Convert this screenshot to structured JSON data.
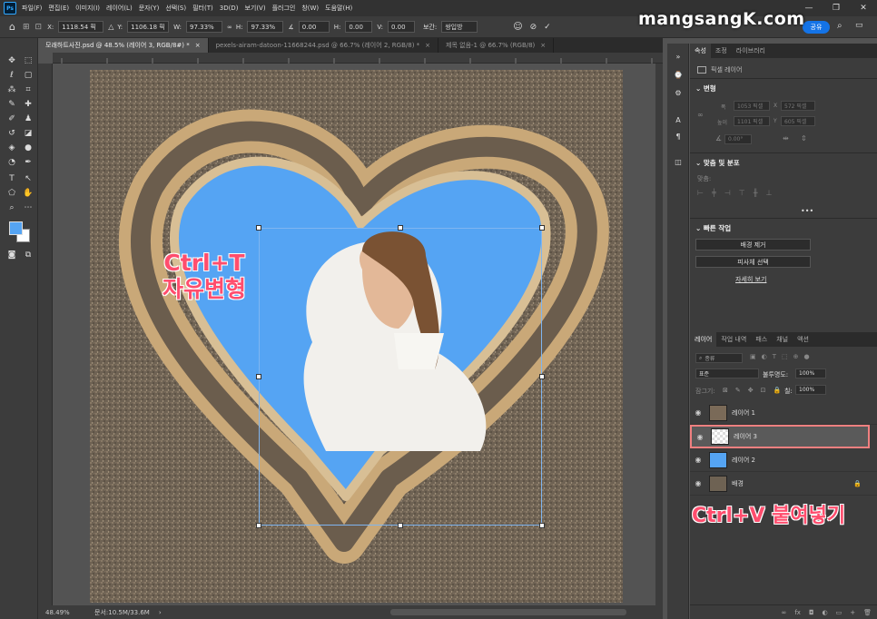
{
  "menubar": {
    "logo": "Ps",
    "items": [
      "파일(F)",
      "편집(E)",
      "이미지(I)",
      "레이어(L)",
      "문자(Y)",
      "선택(S)",
      "필터(T)",
      "3D(D)",
      "보기(V)",
      "플러그인",
      "창(W)",
      "도움말(H)"
    ],
    "window_controls": [
      "—",
      "❐",
      "✕"
    ]
  },
  "options": {
    "x_label": "X:",
    "x_value": "1118.54 픽",
    "y_label": "Y:",
    "y_value": "1106.18 픽",
    "w_label": "W:",
    "w_value": "97.33%",
    "h_label": "H:",
    "h_value": "97.33%",
    "angle_value": "0.00",
    "hskew_label": "H:",
    "hskew_value": "0.00",
    "vskew_label": "V:",
    "vskew_value": "0.00",
    "interp_label": "보간:",
    "interp_value": "쌍입방",
    "share_label": "공유"
  },
  "watermark": "mangsangK.com",
  "tabs": [
    {
      "label": "모래하트사진.psd @ 48.5% (레이어 3, RGB/8#) *",
      "close": "×"
    },
    {
      "label": "pexels-airam-datoon-11668244.psd @ 66.7% (레이어 2, RGB/8) *",
      "close": "×"
    },
    {
      "label": "제목 없음-1 @ 66.7% (RGB/8)",
      "close": "×"
    }
  ],
  "annotations": {
    "ctrl_t_line1": "Ctrl+T",
    "ctrl_t_line2": "자유변형",
    "ctrl_v": "Ctrl+V 붙여넣기"
  },
  "status": {
    "zoom": "48.49%",
    "doc": "문서:10.5M/33.6M",
    "arrow": "›"
  },
  "properties": {
    "tabs": [
      "속성",
      "조정",
      "라이브러리"
    ],
    "layer_kind": "픽셀 레이어",
    "transform_title": "변형",
    "w_label": "폭",
    "w_value": "1053 픽셀",
    "x_label": "X",
    "x_value": "572 픽셀",
    "h_label": "높이",
    "h_value": "1101 픽셀",
    "y_label": "Y",
    "y_value": "605 픽셀",
    "angle_value": "0.00°",
    "align_title": "맞춤 및 분포",
    "align_label": "맞춤:",
    "more": "•••",
    "quick_title": "빠른 작업",
    "btn_remove_bg": "배경 제거",
    "btn_select_subject": "피사체 선택",
    "link_more": "자세히 보기"
  },
  "layers_panel": {
    "tabs": [
      "레이어",
      "작업 내역",
      "패스",
      "채널",
      "액션"
    ],
    "search_placeholder": "종류",
    "blend_mode": "표준",
    "opacity_label": "불투명도:",
    "opacity_value": "100%",
    "lock_label": "잠그기:",
    "fill_label": "칠:",
    "fill_value": "100%",
    "layers": [
      {
        "name": "레이어 1"
      },
      {
        "name": "레이어 3",
        "selected": true
      },
      {
        "name": "레이어 2"
      },
      {
        "name": "배경",
        "locked": true
      }
    ],
    "footer_icons": [
      "∞",
      "fx",
      "◘",
      "◐",
      "▭",
      "+",
      "🗑"
    ]
  }
}
